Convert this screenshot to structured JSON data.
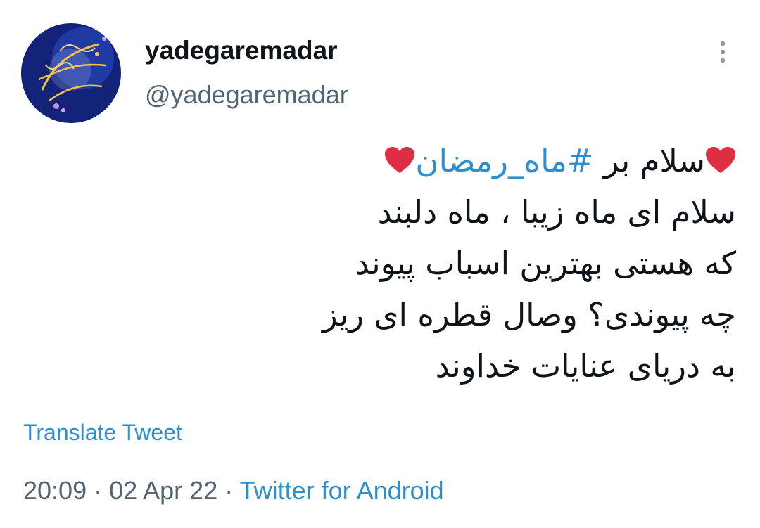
{
  "author": {
    "display_name": "yadegaremadar",
    "handle": "@yadegaremadar",
    "avatar_icon": "calligraphy-avatar"
  },
  "menu": {
    "icon": "more-vertical-icon"
  },
  "tweet": {
    "line1_before": "سلام بر ",
    "hashtag": "#ماه_رمضان",
    "line2": "سلام ای ماه زیبا ، ماه دلبند",
    "line3": "که هستی بهترین اسباب پیوند",
    "line4": "چه پیوندی؟ وصال قطره ای ریز",
    "line5": "به دریای عنایات خداوند",
    "heart_color": "#dd2e44"
  },
  "translate_label": "Translate Tweet",
  "meta": {
    "time": "20:09",
    "sep1": " · ",
    "date": "02 Apr 22",
    "sep2": " · ",
    "source": "Twitter for Android"
  },
  "colors": {
    "link": "#2b8fd0",
    "muted": "#536471",
    "text": "#0f1419"
  }
}
